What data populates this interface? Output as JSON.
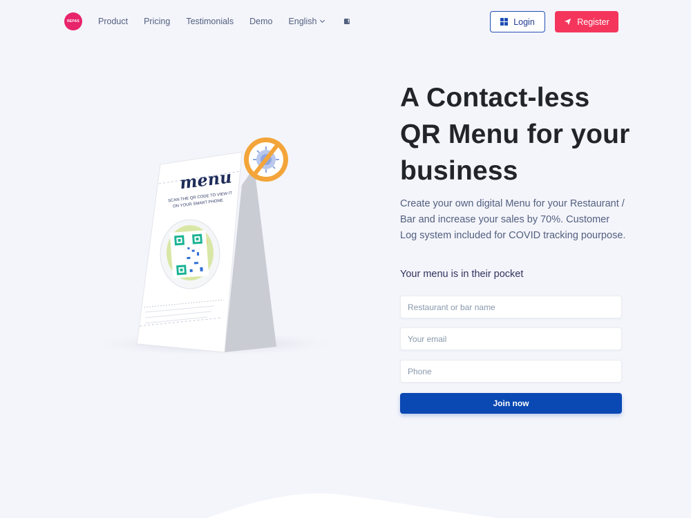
{
  "brand": {
    "logo_text": "REPAS",
    "color": "#e8246a"
  },
  "nav": {
    "links": [
      "Product",
      "Pricing",
      "Testimonials",
      "Demo"
    ],
    "language": "English",
    "social_icon": "facebook-icon"
  },
  "auth": {
    "login_label": "Login",
    "register_label": "Register"
  },
  "hero": {
    "headline": "A Contact-less QR Menu for your business",
    "description": " Create your own digital Menu for your Restaurant / Bar and increase your sales by 70%. Customer Log system included for COVID tracking pourpose.",
    "tagline": "Your menu is in their pocket"
  },
  "illustration": {
    "menu_title": "menu",
    "menu_subtitle_1": "SCAN THE QR CODE TO VIEW IT",
    "menu_subtitle_2": "ON YOUR SMART PHONE"
  },
  "form": {
    "name_placeholder": "Restaurant or bar name",
    "email_placeholder": "Your email",
    "phone_placeholder": "Phone",
    "submit_label": "Join now"
  },
  "colors": {
    "primary": "#0a48b3",
    "accent": "#f5365c",
    "background": "#f4f5fb"
  }
}
